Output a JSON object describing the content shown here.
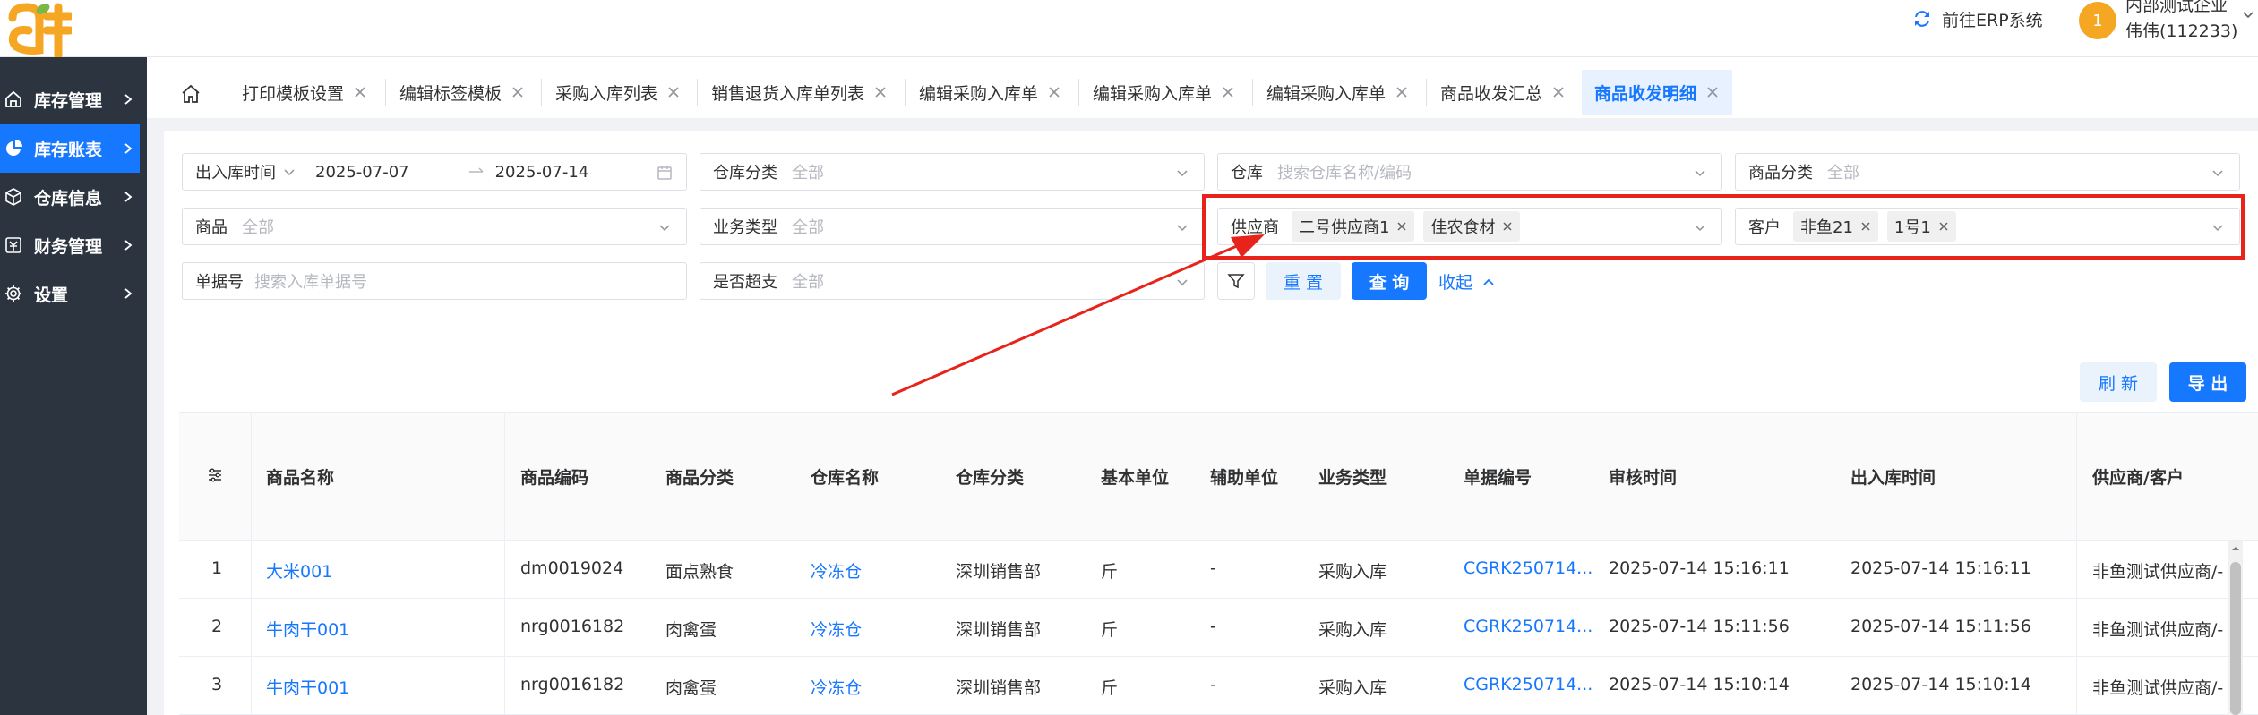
{
  "header": {
    "erp_link": "前往ERP系统",
    "avatar_text": "1",
    "company": "内部测试企业",
    "user": "伟伟(112233)"
  },
  "sidebar": {
    "items": [
      {
        "label": "库存管理",
        "icon": "home-icon"
      },
      {
        "label": "库存账表",
        "icon": "pie-chart-icon"
      },
      {
        "label": "仓库信息",
        "icon": "box-icon"
      },
      {
        "label": "财务管理",
        "icon": "ledger-icon"
      },
      {
        "label": "设置",
        "icon": "gear-icon"
      }
    ],
    "active_index": 1
  },
  "tabs": [
    {
      "label": "打印模板设置"
    },
    {
      "label": "编辑标签模板"
    },
    {
      "label": "采购入库列表"
    },
    {
      "label": "销售退货入库单列表"
    },
    {
      "label": "编辑采购入库单"
    },
    {
      "label": "编辑采购入库单"
    },
    {
      "label": "编辑采购入库单"
    },
    {
      "label": "商品收发汇总"
    },
    {
      "label": "商品收发明细"
    }
  ],
  "filters": {
    "date_label": "出入库时间",
    "date_start": "2025-07-07",
    "date_end": "2025-07-14",
    "warehouse_category_label": "仓库分类",
    "warehouse_category_value": "全部",
    "warehouse_label": "仓库",
    "warehouse_placeholder": "搜索仓库名称/编码",
    "product_category_label": "商品分类",
    "product_category_value": "全部",
    "product_label": "商品",
    "product_value": "全部",
    "business_type_label": "业务类型",
    "business_type_value": "全部",
    "supplier_label": "供应商",
    "supplier_tags": [
      "二号供应商1",
      "佳农食材"
    ],
    "customer_label": "客户",
    "customer_tags": [
      "非鱼21",
      "1号1"
    ],
    "doc_no_label": "单据号",
    "doc_no_placeholder": "搜索入库单据号",
    "over_receive_label": "是否超支",
    "over_receive_value": "全部",
    "reset_label": "重 置",
    "query_label": "查 询",
    "collapse_label": "收起"
  },
  "toolbar": {
    "refresh_label": "刷 新",
    "export_label": "导 出"
  },
  "table": {
    "columns": [
      "商品名称",
      "商品编码",
      "商品分类",
      "仓库名称",
      "仓库分类",
      "基本单位",
      "辅助单位",
      "业务类型",
      "单据编号",
      "审核时间",
      "出入库时间",
      "供应商/客户"
    ],
    "rows": [
      {
        "idx": "1",
        "name": "大米001",
        "code": "dm0019024",
        "category": "面点熟食",
        "warehouse": "冷冻仓",
        "wh_category": "深圳销售部",
        "unit": "斤",
        "aux_unit": "-",
        "biz_type": "采购入库",
        "doc_no": "CGRK250714...",
        "audit_time": "2025-07-14 15:16:11",
        "io_time": "2025-07-14 15:16:11",
        "partner": "非鱼测试供应商/-"
      },
      {
        "idx": "2",
        "name": "牛肉干001",
        "code": "nrg0016182",
        "category": "肉禽蛋",
        "warehouse": "冷冻仓",
        "wh_category": "深圳销售部",
        "unit": "斤",
        "aux_unit": "-",
        "biz_type": "采购入库",
        "doc_no": "CGRK250714...",
        "audit_time": "2025-07-14 15:11:56",
        "io_time": "2025-07-14 15:11:56",
        "partner": "非鱼测试供应商/-"
      },
      {
        "idx": "3",
        "name": "牛肉干001",
        "code": "nrg0016182",
        "category": "肉禽蛋",
        "warehouse": "冷冻仓",
        "wh_category": "深圳销售部",
        "unit": "斤",
        "aux_unit": "-",
        "biz_type": "采购入库",
        "doc_no": "CGRK250714...",
        "audit_time": "2025-07-14 15:10:14",
        "io_time": "2025-07-14 15:10:14",
        "partner": "非鱼测试供应商/-"
      }
    ]
  },
  "colors": {
    "primary": "#1677ff",
    "sidebar_bg": "#2c3440",
    "highlight_red": "#e8231b",
    "logo_orange": "#f5a623"
  }
}
